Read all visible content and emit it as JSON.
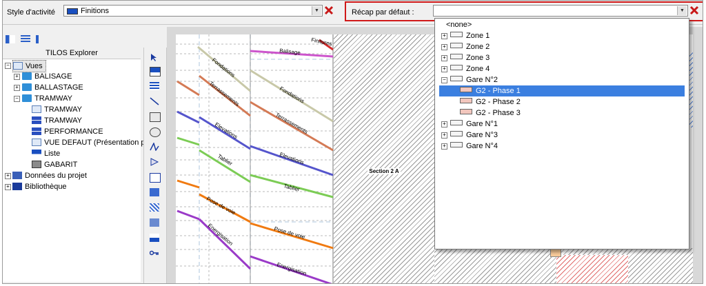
{
  "toolbar": {
    "activity_style_label": "Style d'activité",
    "activity_style_value": "Finitions",
    "recap_label": "Récap par défaut :",
    "recap_value": ""
  },
  "explorer": {
    "title": "TILOS Explorer",
    "tree": {
      "vues": "Vues",
      "balisage": "BALISAGE",
      "ballastage": "BALLASTAGE",
      "tramway": "TRAMWAY",
      "tramway_grid": "TRAMWAY",
      "tramway_bars": "TRAMWAY",
      "performance": "PERFORMANCE",
      "vue_defaut": "VUE DEFAUT (Présentation pa",
      "liste": "Liste",
      "gabarit": "GABARIT",
      "donnees": "Données du projet",
      "bibliotheque": "Bibliothèque"
    }
  },
  "chart": {
    "section_label": "Section 2 A",
    "labels": {
      "finitures": "Finitures",
      "balisage": "Balisage",
      "fondations_1": "Fondations",
      "fondations_2": "Fondations",
      "terrassements_1": "Terrassements",
      "terrassements_2": "Terrassements",
      "elevations_1": "Elevations",
      "elevations_2": "Elevations",
      "tablier_1": "Tablier",
      "tablier_2": "Tablier",
      "pose_de_voie_1": "Pose de voie",
      "pose_de_voie_2": "Pose de voie",
      "energisation_1": "Energisation",
      "energisation_2": "Energisation"
    },
    "colors": {
      "finitures": "#d42b2b",
      "balisage": "#cc55cc",
      "fondations": "#c8c8a8",
      "terrassements": "#d47a55",
      "elevations": "#5555cc",
      "tablier": "#7ccc55",
      "pose_de_voie": "#f07a10",
      "energisation": "#9a3ac8"
    }
  },
  "dropdown": {
    "none": "<none>",
    "zone1": "Zone 1",
    "zone2": "Zone 2",
    "zone3": "Zone 3",
    "zone4": "Zone 4",
    "gare2": "Gare N°2",
    "g2p1": "G2 - Phase 1",
    "g2p2": "G2 - Phase 2",
    "g2p3": "G2 - Phase 3",
    "gare1": "Gare N°1",
    "gare3": "Gare N°3",
    "gare4": "Gare N°4"
  }
}
